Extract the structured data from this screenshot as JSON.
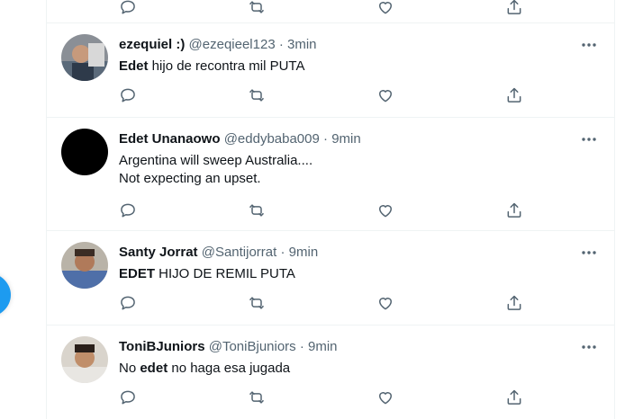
{
  "icons": {
    "reply": "reply-icon",
    "retweet": "retweet-icon",
    "like": "like-icon",
    "share": "share-icon",
    "more": "more-icon"
  },
  "colors": {
    "text": "#0f1419",
    "muted": "#536471",
    "divider": "#eff3f4",
    "accent": "#1d9bf0"
  },
  "tweets": [
    {
      "name": "ezequiel :)",
      "handle": "@ezeqieel123",
      "sep": "·",
      "time": "3min",
      "text_bold": "Edet",
      "text_rest": " hijo de recontra mil PUTA"
    },
    {
      "name": "Edet Unanaowo",
      "handle": "@eddybaba009",
      "sep": "·",
      "time": "9min",
      "line1": "Argentina will sweep Australia....",
      "line2": "Not expecting an upset."
    },
    {
      "name": "Santy Jorrat",
      "handle": "@Santijorrat",
      "sep": "·",
      "time": "9min",
      "text_bold": "EDET",
      "text_rest": " HIJO DE REMIL PUTA"
    },
    {
      "name": "ToniBJuniors",
      "handle": "@ToniBjuniors",
      "sep": "·",
      "time": "9min",
      "text_pre": "No ",
      "text_bold": "edet",
      "text_rest": " no haga esa jugada"
    }
  ]
}
